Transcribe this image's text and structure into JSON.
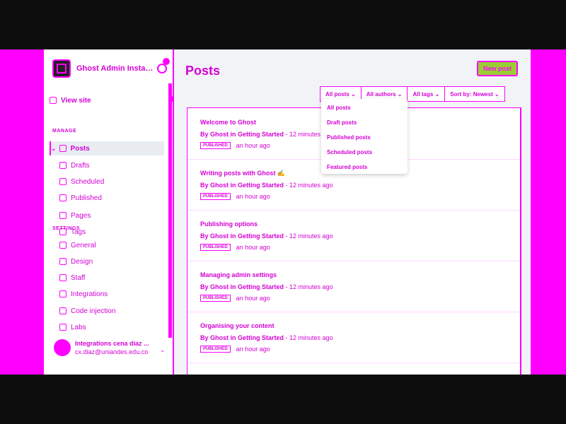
{
  "sidebar": {
    "brand_name": "Ghost Admin Instance...",
    "view_site": "View site",
    "manage_label": "MANAGE",
    "posts": "Posts",
    "drafts": "Drafts",
    "scheduled": "Scheduled",
    "published": "Published",
    "pages": "Pages",
    "tags": "Tags",
    "staff": "Staff",
    "settings_label": "SETTINGS",
    "general": "General",
    "design": "Design",
    "code_injection": "Code injection",
    "integrations": "Integrations",
    "labs": "Labs",
    "user_name": "Integrations cena diaz ...",
    "user_email": "cx.diaz@uniandes.edu.co"
  },
  "header": {
    "title": "Posts",
    "new_post": "New post"
  },
  "filters": {
    "type": "All posts",
    "author": "All authors",
    "tags": "All tags",
    "sort": "Sort by: Newest"
  },
  "dropdown": {
    "items": [
      "All posts",
      "Draft posts",
      "Published posts",
      "Scheduled posts",
      "Featured posts"
    ]
  },
  "posts": [
    {
      "title": "Welcome to Ghost",
      "author": "By Ghost in Getting Started",
      "time_ago": "- 12 minutes ago",
      "status": "PUBLISHED",
      "updated": "an hour ago"
    },
    {
      "title": "Writing posts with Ghost ✍️",
      "author": "By Ghost in Getting Started",
      "time_ago": "- 12 minutes ago",
      "status": "PUBLISHED",
      "updated": "an hour ago"
    },
    {
      "title": "Publishing options",
      "author": "By Ghost in Getting Started",
      "time_ago": "- 12 minutes ago",
      "status": "PUBLISHED",
      "updated": "an hour ago"
    },
    {
      "title": "Managing admin settings",
      "author": "By Ghost in Getting Started",
      "time_ago": "- 12 minutes ago",
      "status": "PUBLISHED",
      "updated": "an hour ago"
    },
    {
      "title": "Organising your content",
      "author": "By Ghost in Getting Started",
      "time_ago": "- 12 minutes ago",
      "status": "PUBLISHED",
      "updated": "an hour ago"
    }
  ],
  "colors": {
    "accent": "#ff00ff",
    "new_post_bg": "#9acd32"
  }
}
